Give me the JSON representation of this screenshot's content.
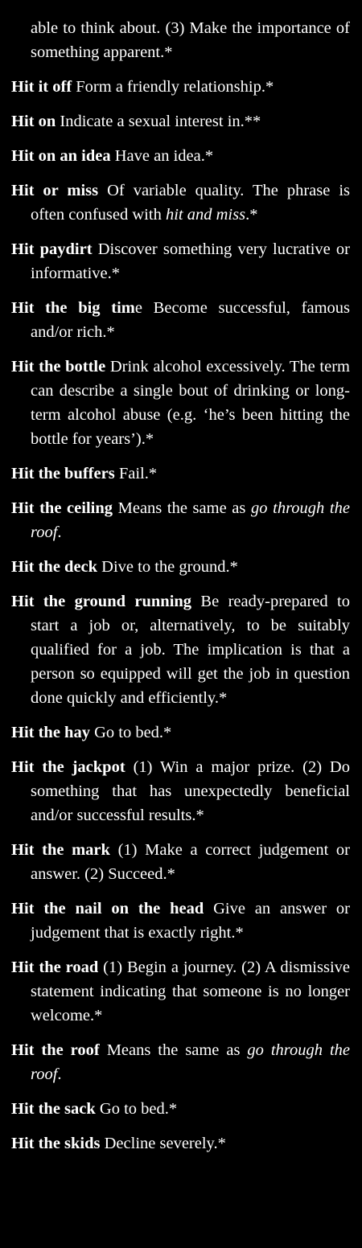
{
  "continuation": "able to think about. (3) Make the importance of something apparent.*",
  "entries": [
    {
      "term": "Hit it off",
      "definition": " Form a friendly relationship.*"
    },
    {
      "term": "Hit on",
      "definition": " Indicate a sexual interest in.**"
    },
    {
      "term": "Hit on an idea",
      "definition": " Have an idea.*"
    },
    {
      "term": "Hit or miss",
      "definition": " Of variable quality. The phrase is often confused with ",
      "xref": "hit and miss",
      "after": ".*"
    },
    {
      "term": "Hit paydirt",
      "definition": " Discover something very lucrative or informative.*"
    },
    {
      "term": "Hit the big tim",
      "definition": "e Become successful, famous and/or rich.*"
    },
    {
      "term": "Hit the bottle",
      "definition": " Drink alcohol excessively. The term can describe a single bout of drinking or long-term alcohol abuse (e.g. ‘he’s been hitting the bottle for years’).*"
    },
    {
      "term": "Hit the buffers",
      "definition": " Fail.*"
    },
    {
      "term": "Hit the ceiling",
      "definition": " Means the same as ",
      "xref": "go through the roof",
      "after": "."
    },
    {
      "term": "Hit the deck",
      "definition": " Dive to the ground.*"
    },
    {
      "term": "Hit the ground running",
      "definition": " Be ready-prepared to start a job or, alternatively, to be suitably qualified for a job. The implication is that a person so equipped will get the job in question done quickly and efficiently.*"
    },
    {
      "term": "Hit the hay",
      "definition": " Go to bed.*"
    },
    {
      "term": "Hit the jackpot",
      "definition": " (1) Win a major prize. (2) Do something that has unexpectedly beneficial and/or successful results.*"
    },
    {
      "term": "Hit the mark",
      "definition": " (1) Make a correct judgement or answer. (2) Succeed.*"
    },
    {
      "term": "Hit the nail on the head",
      "definition": " Give an answer or judgement that is exactly right.*"
    },
    {
      "term": "Hit the road",
      "definition": " (1) Begin a journey. (2) A dismissive statement indicating that someone is no longer welcome.*"
    },
    {
      "term": "Hit the roof",
      "definition": " Means the same as ",
      "xref": "go through the roof",
      "after": "."
    },
    {
      "term": "Hit the sack",
      "definition": " Go to bed.*"
    },
    {
      "term": "Hit the skids",
      "definition": " Decline severely.*"
    }
  ]
}
